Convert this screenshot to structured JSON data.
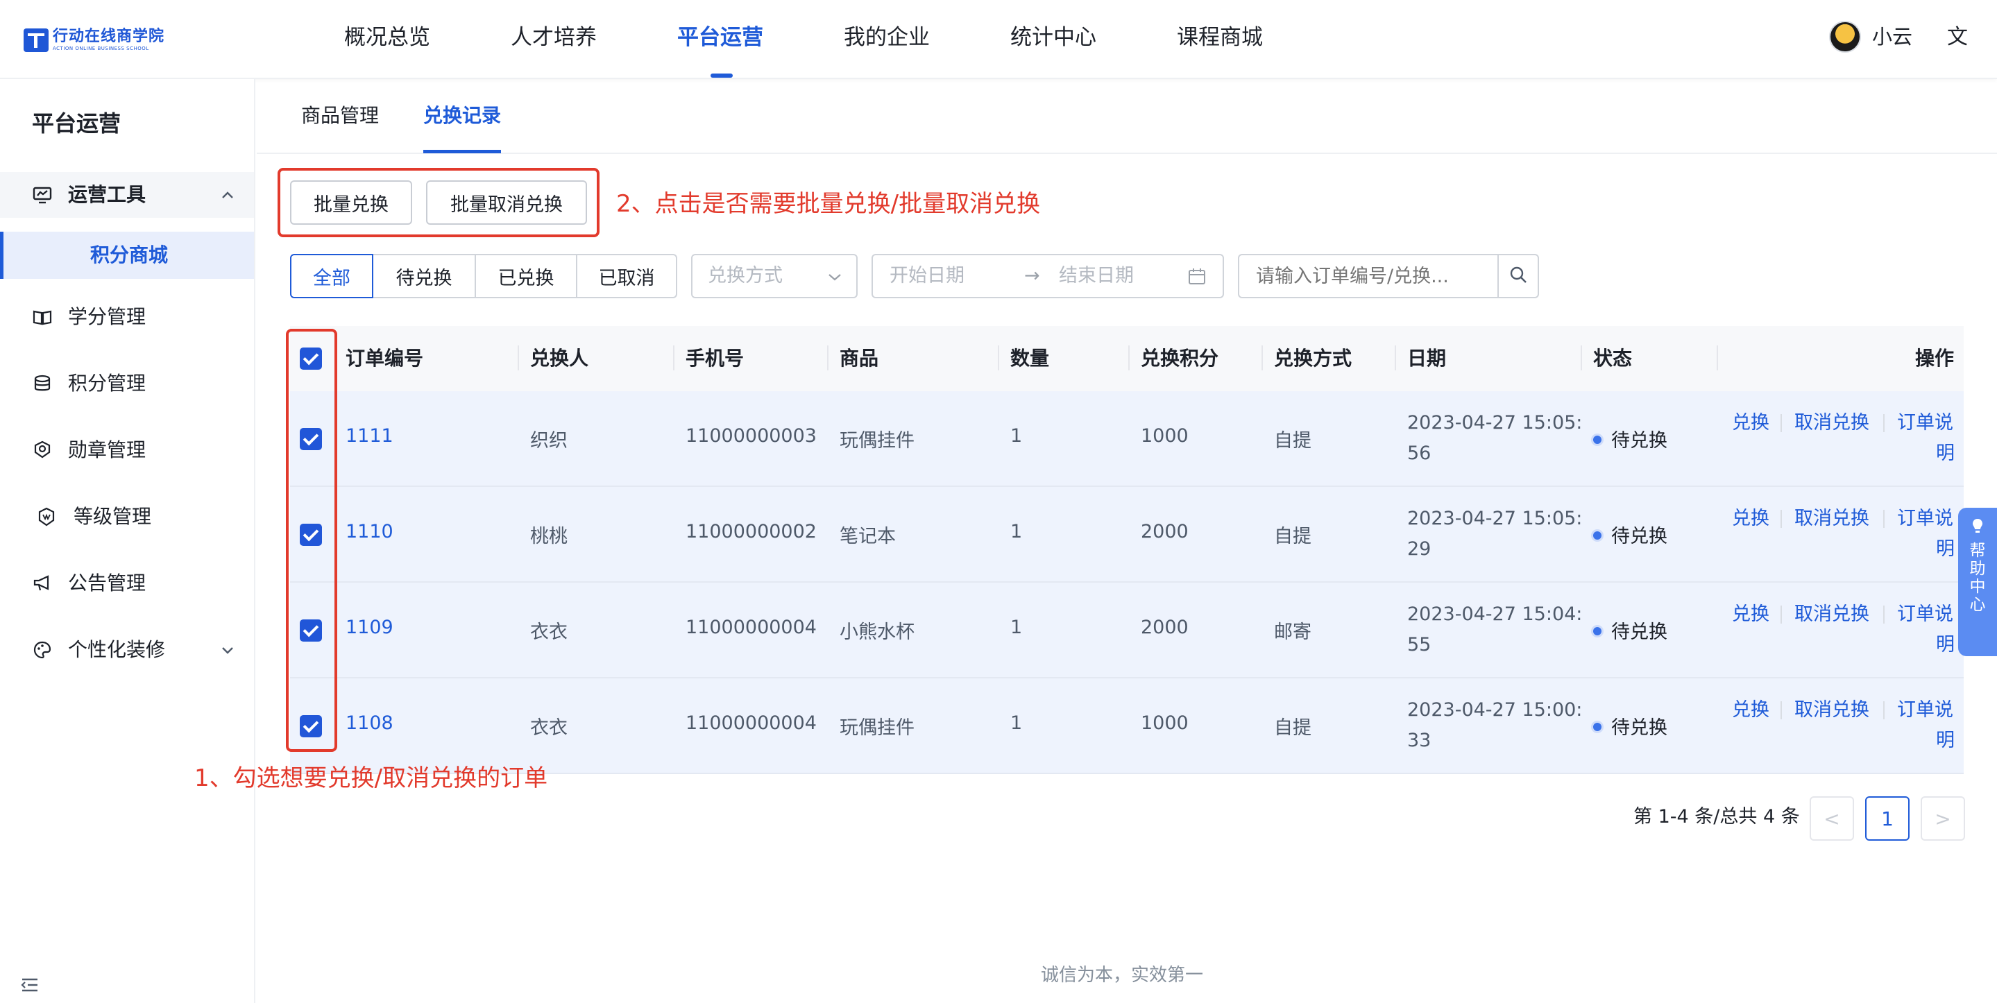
{
  "brand": {
    "name_cn": "行动在线商学院",
    "name_en": "ACTION ONLINE BUSINESS SCHOOL"
  },
  "nav": {
    "items": [
      "概况总览",
      "人才培养",
      "平台运营",
      "我的企业",
      "统计中心",
      "课程商城"
    ],
    "active": "平台运营"
  },
  "user": {
    "name": "小云"
  },
  "sidebar": {
    "title": "平台运营",
    "group_label": "运营工具",
    "sub_active": "积分商城",
    "items": [
      "学分管理",
      "积分管理",
      "勋章管理",
      "等级管理",
      "公告管理",
      "个性化装修"
    ]
  },
  "tabs": [
    "商品管理",
    "兑换记录"
  ],
  "active_tab": "兑换记录",
  "actions": {
    "batch_redeem": "批量兑换",
    "batch_cancel": "批量取消兑换"
  },
  "annotations": {
    "step2": "2、点击是否需要批量兑换/批量取消兑换",
    "step1": "1、勾选想要兑换/取消兑换的订单"
  },
  "filters": {
    "segments": [
      "全部",
      "待兑换",
      "已兑换",
      "已取消"
    ],
    "active_segment": "全部",
    "method_placeholder": "兑换方式",
    "start_placeholder": "开始日期",
    "end_placeholder": "结束日期",
    "search_placeholder": "请输入订单编号/兑换..."
  },
  "table": {
    "headers": [
      "订单编号",
      "兑换人",
      "手机号",
      "商品",
      "数量",
      "兑换积分",
      "兑换方式",
      "日期",
      "状态",
      "操作"
    ],
    "rows": [
      {
        "order": "1111",
        "person": "织织",
        "phone": "11000000003",
        "product": "玩偶挂件",
        "qty": "1",
        "points": "1000",
        "method": "自提",
        "date1": "2023-04-27 15:05:",
        "date2": "56",
        "status": "待兑换"
      },
      {
        "order": "1110",
        "person": "桃桃",
        "phone": "11000000002",
        "product": "笔记本",
        "qty": "1",
        "points": "2000",
        "method": "自提",
        "date1": "2023-04-27 15:05:",
        "date2": "29",
        "status": "待兑换"
      },
      {
        "order": "1109",
        "person": "衣衣",
        "phone": "11000000004",
        "product": "小熊水杯",
        "qty": "1",
        "points": "2000",
        "method": "邮寄",
        "date1": "2023-04-27 15:04:",
        "date2": "55",
        "status": "待兑换"
      },
      {
        "order": "1108",
        "person": "衣衣",
        "phone": "11000000004",
        "product": "玩偶挂件",
        "qty": "1",
        "points": "1000",
        "method": "自提",
        "date1": "2023-04-27 15:00:",
        "date2": "33",
        "status": "待兑换"
      }
    ],
    "ops": {
      "redeem": "兑换",
      "cancel": "取消兑换",
      "note1": "订单说",
      "note2": "明"
    }
  },
  "pagination": {
    "info": "第 1-4 条/总共 4 条",
    "current": "1",
    "prev": "<",
    "next": ">"
  },
  "footer": "诚信为本，实效第一",
  "help": {
    "label": "帮助中心"
  },
  "colors": {
    "primary": "#1f5bd8",
    "annotation": "#e23a2c",
    "row_selected": "#eef3fd"
  }
}
